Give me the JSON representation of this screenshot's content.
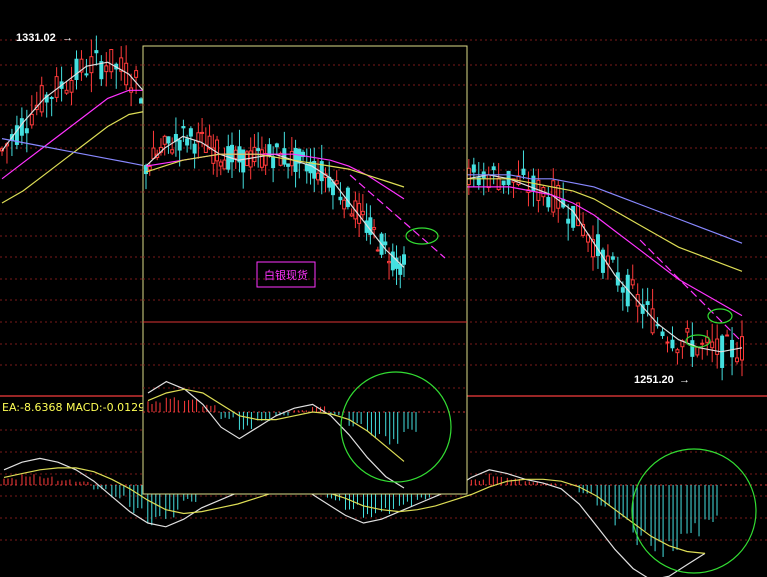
{
  "chart_data": [
    {
      "type": "candlestick",
      "panel": "main",
      "annotations": [
        {
          "text": "1331.02",
          "value": 1331.02,
          "kind": "high"
        },
        {
          "text": "1251.20",
          "value": 1251.2,
          "kind": "low"
        }
      ],
      "ylim": [
        1245,
        1335
      ],
      "grid": true,
      "series": [
        {
          "key": "ma1",
          "color": "#e0e0e0",
          "values": [
            1305,
            1312,
            1318,
            1322,
            1326,
            1327,
            1324,
            1318,
            1312,
            1306,
            1300,
            1298,
            1296,
            1300,
            1303,
            1300,
            1298,
            1295,
            1293,
            1290,
            1292,
            1295,
            1298,
            1299,
            1298,
            1296,
            1294,
            1290,
            1282,
            1274,
            1268,
            1262,
            1258,
            1256,
            1255,
            1256
          ]
        },
        {
          "key": "ma2",
          "color": "#ff33ff",
          "values": [
            1298,
            1302,
            1306,
            1310,
            1314,
            1318,
            1320,
            1320,
            1318,
            1314,
            1310,
            1306,
            1302,
            1301,
            1300,
            1300,
            1299,
            1298,
            1297,
            1296,
            1296,
            1296,
            1296,
            1296,
            1296,
            1295,
            1294,
            1292,
            1289,
            1285,
            1281,
            1277,
            1273,
            1270,
            1267,
            1264
          ]
        },
        {
          "key": "ma3",
          "color": "#dddd55",
          "values": [
            1292,
            1295,
            1299,
            1303,
            1307,
            1311,
            1314,
            1315,
            1315,
            1313,
            1310,
            1307,
            1304,
            1302,
            1301,
            1300,
            1299,
            1299,
            1298,
            1298,
            1298,
            1298,
            1298,
            1298,
            1298,
            1297,
            1296,
            1295,
            1293,
            1290,
            1287,
            1284,
            1281,
            1279,
            1277,
            1275
          ]
        },
        {
          "key": "ma4",
          "color": "#8888ff",
          "values": [
            1308,
            1307,
            1306,
            1305,
            1304,
            1303,
            1302,
            1301,
            1300,
            1300,
            1299,
            1299,
            1299,
            1299,
            1299,
            1299,
            1299,
            1299,
            1299,
            1299,
            1299,
            1299,
            1299,
            1299,
            1299,
            1298,
            1298,
            1297,
            1296,
            1294,
            1292,
            1290,
            1288,
            1286,
            1284,
            1282
          ]
        }
      ]
    },
    {
      "type": "bar",
      "panel": "macd",
      "label_text": "EA:-8.6368 MACD:-0.0129",
      "values": [
        4,
        6,
        5,
        3,
        2,
        -3,
        -8,
        -15,
        -22,
        -18,
        -10,
        -5,
        -2,
        1,
        3,
        2,
        -1,
        -4,
        -9,
        -14,
        -18,
        -16,
        -12,
        -8,
        -4,
        -1,
        3,
        6,
        4,
        2,
        1,
        0,
        -5,
        -14,
        -24,
        -32,
        -38,
        -35,
        -28,
        -20
      ],
      "lines": [
        {
          "key": "dif",
          "color": "#e0e0e0",
          "values": [
            8,
            12,
            14,
            12,
            8,
            2,
            -6,
            -14,
            -20,
            -22,
            -18,
            -12,
            -8,
            -4,
            0,
            2,
            0,
            -4,
            -10,
            -16,
            -20,
            -18,
            -14,
            -10,
            -6,
            -2,
            4,
            8,
            6,
            3,
            1,
            -2,
            -10,
            -22,
            -34,
            -44,
            -50,
            -48,
            -42,
            -36
          ]
        },
        {
          "key": "dea",
          "color": "#dddd55",
          "values": [
            4,
            6,
            8,
            9,
            9,
            7,
            3,
            -2,
            -8,
            -13,
            -15,
            -14,
            -12,
            -10,
            -7,
            -4,
            -2,
            -2,
            -4,
            -7,
            -11,
            -13,
            -14,
            -13,
            -11,
            -8,
            -5,
            -1,
            2,
            3,
            3,
            2,
            -1,
            -6,
            -13,
            -20,
            -27,
            -32,
            -35,
            -36
          ]
        }
      ]
    },
    {
      "type": "candlestick",
      "panel": "inset",
      "title": "白银现货",
      "ylim": [
        1245,
        1335
      ],
      "series": [
        {
          "key": "ma1",
          "color": "#e0e0e0",
          "values": [
            1296,
            1302,
            1306,
            1304,
            1300,
            1298,
            1299,
            1300,
            1298,
            1296,
            1292,
            1284,
            1276,
            1268,
            1262
          ]
        },
        {
          "key": "ma2",
          "color": "#ff33ff",
          "values": [
            1296,
            1297,
            1298,
            1299,
            1300,
            1300,
            1300,
            1300,
            1300,
            1299,
            1298,
            1296,
            1293,
            1289,
            1285
          ]
        },
        {
          "key": "ma3",
          "color": "#dddd55",
          "values": [
            1294,
            1296,
            1298,
            1299,
            1300,
            1300,
            1300,
            1299,
            1298,
            1297,
            1296,
            1295,
            1293,
            1291,
            1289
          ]
        }
      ],
      "macd_values": [
        6,
        8,
        7,
        4,
        -4,
        -10,
        -6,
        -2,
        1,
        3,
        -2,
        -8,
        -14,
        -18,
        -12
      ],
      "macd_lines": [
        {
          "key": "dif",
          "color": "#e0e0e0",
          "values": [
            10,
            16,
            12,
            4,
            -8,
            -14,
            -8,
            -2,
            2,
            4,
            -2,
            -12,
            -24,
            -34,
            -40
          ]
        },
        {
          "key": "dea",
          "color": "#dddd55",
          "values": [
            6,
            10,
            12,
            10,
            4,
            -2,
            -4,
            -4,
            -2,
            0,
            -1,
            -4,
            -10,
            -18,
            -26
          ]
        }
      ]
    }
  ]
}
